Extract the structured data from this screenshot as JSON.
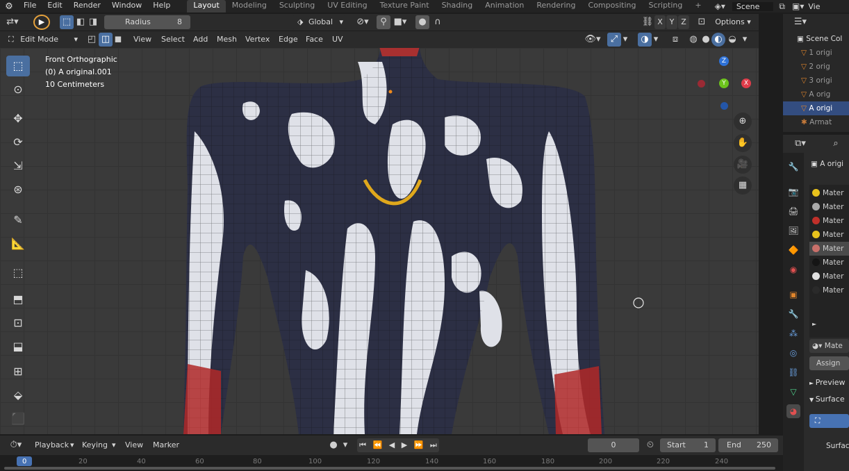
{
  "menu": {
    "app_icon": "blender-logo-icon",
    "items": [
      "File",
      "Edit",
      "Render",
      "Window",
      "Help"
    ],
    "workspaces": [
      "Layout",
      "Modeling",
      "Sculpting",
      "UV Editing",
      "Texture Paint",
      "Shading",
      "Animation",
      "Rendering",
      "Compositing",
      "Scripting"
    ],
    "active_workspace": "Layout",
    "add_workspace": "+",
    "scene_label": "Scene",
    "view_layer_label": "Vie"
  },
  "tool_header": {
    "radius_label": "Radius",
    "radius_value": "8",
    "transform_orientation": "Global",
    "axes": [
      "X",
      "Y",
      "Z"
    ],
    "options_label": "Options"
  },
  "mode_header": {
    "mode": "Edit Mode",
    "menus": [
      "View",
      "Select",
      "Add",
      "Mesh",
      "Vertex",
      "Edge",
      "Face",
      "UV"
    ]
  },
  "viewport": {
    "view_name": "Front Orthographic",
    "object_name": "(0) A original.001",
    "scale": "10 Centimeters",
    "gizmo": {
      "z": "Z",
      "y": "Y",
      "x": "X"
    }
  },
  "timeline": {
    "menus": [
      "Playback",
      "Keying",
      "View",
      "Marker"
    ],
    "current_frame": "0",
    "start_label": "Start",
    "start_value": "1",
    "end_label": "End",
    "end_value": "250",
    "ruler_ticks": [
      "0",
      "20",
      "40",
      "60",
      "80",
      "100",
      "120",
      "140",
      "160",
      "180",
      "200",
      "220",
      "240"
    ]
  },
  "outliner": {
    "title": "Scene Col",
    "rows": [
      "1 origi",
      "2 orig",
      "3 origi",
      "A orig",
      "A origi",
      "Armat"
    ],
    "active_row": 4
  },
  "properties": {
    "object_name": "A origi",
    "materials": [
      {
        "label": "Mater",
        "color": "#e8c21c"
      },
      {
        "label": "Mater",
        "color": "#aaaaaa"
      },
      {
        "label": "Mater",
        "color": "#c0302a"
      },
      {
        "label": "Mater",
        "color": "#e8c21c"
      },
      {
        "label": "Mater",
        "color": "#c9706a"
      },
      {
        "label": "Mater",
        "color": "#151515"
      },
      {
        "label": "Mater",
        "color": "#e0e0e0"
      },
      {
        "label": "Mater",
        "color": "#2a2a2a"
      }
    ],
    "active_material": 4,
    "material_field": "Mate",
    "assign_label": "Assign",
    "preview_label": "Preview",
    "surface_label": "Surface",
    "surface_field": "Surfac"
  }
}
